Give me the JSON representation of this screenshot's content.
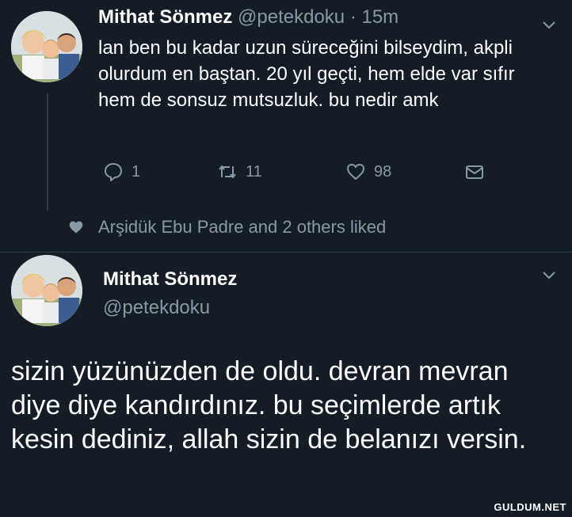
{
  "tweet1": {
    "author_name": "Mithat Sönmez",
    "handle": "@petekdoku",
    "separator": "·",
    "time": "15m",
    "text": "lan ben bu kadar uzun süreceğini bilseydim, akpli olurdum en baştan. 20 yıl geçti, hem elde var sıfır hem de sonsuz mutsuzluk. bu nedir amk",
    "replies": "1",
    "retweets": "11",
    "likes": "98",
    "icons": [
      "reply-icon",
      "retweet-icon",
      "heart-icon",
      "message-icon",
      "chevron-down-icon"
    ]
  },
  "liked_by": {
    "text": "Arşidük Ebu Padre and 2 others liked",
    "icon": "heart-filled-icon"
  },
  "tweet2": {
    "author_name": "Mithat Sönmez",
    "handle": "@petekdoku",
    "text": "sizin yüzünüzden de oldu. devran mevran diye diye kandırdınız. bu seçimlerde artık kesin dediniz, allah sizin de belanızı versin.",
    "icons": [
      "chevron-down-icon"
    ]
  },
  "watermark": "GULDUM.NET",
  "colors": {
    "background": "#141d26",
    "text": "#ffffff",
    "muted": "#8899a6"
  }
}
